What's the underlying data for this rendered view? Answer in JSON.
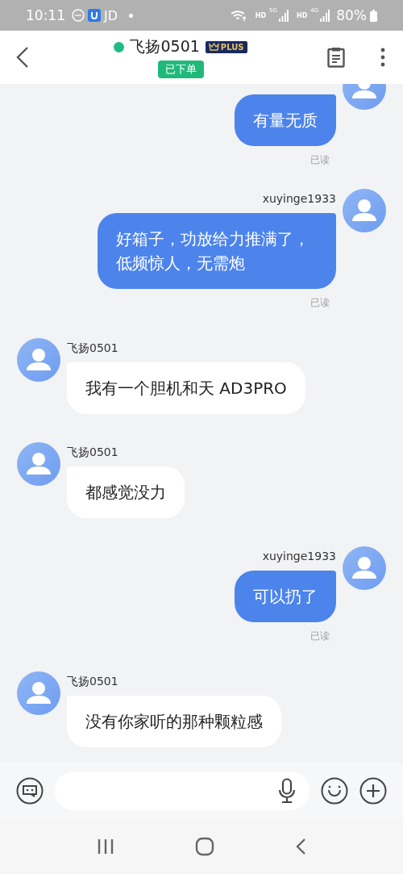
{
  "status_bar": {
    "time": "10:11",
    "app_label": "JD",
    "networks": [
      {
        "hd": "HD",
        "gen": "5G"
      },
      {
        "hd": "HD",
        "gen": "4G"
      }
    ],
    "battery": "80%"
  },
  "header": {
    "contact": "飞扬0501",
    "online": true,
    "membership": "PLUS",
    "order_tag": "已下单"
  },
  "messages": [
    {
      "kind": "sent",
      "text": "有量无质",
      "receipt": "已读"
    },
    {
      "kind": "sent",
      "name": "xuyinge1933",
      "text": "好箱子，功放给力推满了，低频惊人，无需炮",
      "receipt": "已读"
    },
    {
      "kind": "received",
      "name": "飞扬0501",
      "text": "我有一个胆机和天 AD3PRO"
    },
    {
      "kind": "received",
      "name": "飞扬0501",
      "text": "都感觉没力"
    },
    {
      "kind": "sent",
      "name": "xuyinge1933",
      "text": "可以扔了",
      "receipt": "已读"
    },
    {
      "kind": "received",
      "name": "飞扬0501",
      "text": "没有你家听的那种颗粒感"
    }
  ]
}
